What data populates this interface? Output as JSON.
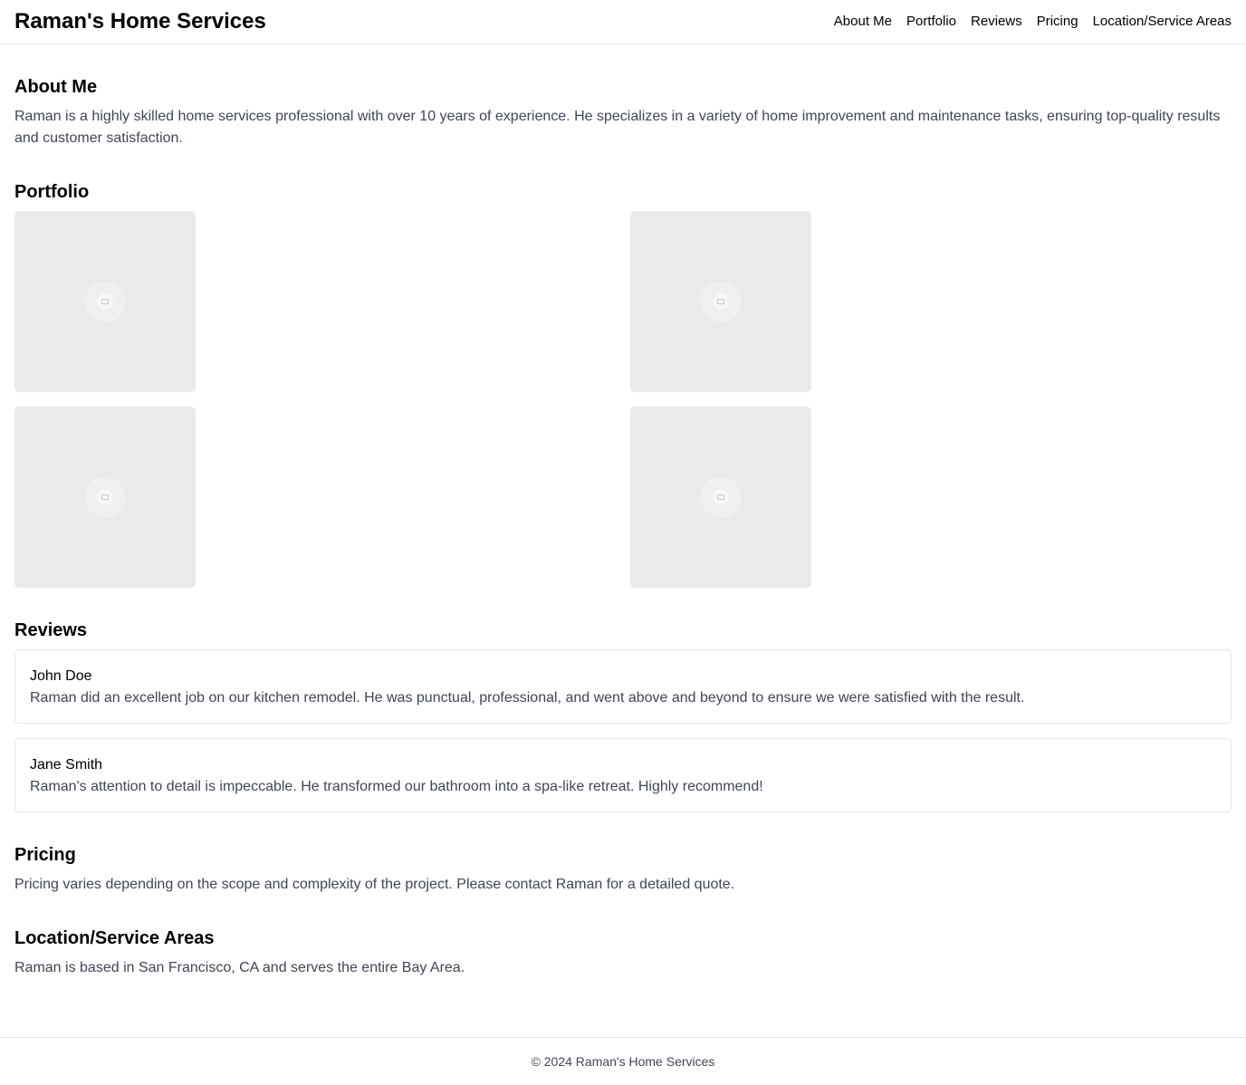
{
  "header": {
    "brand": "Raman's Home Services",
    "nav": [
      "About Me",
      "Portfolio",
      "Reviews",
      "Pricing",
      "Location/Service Areas"
    ]
  },
  "about": {
    "title": "About Me",
    "text": "Raman is a highly skilled home services professional with over 10 years of experience. He specializes in a variety of home improvement and maintenance tasks, ensuring top-quality results and customer satisfaction."
  },
  "portfolio": {
    "title": "Portfolio",
    "images": [
      "image-placeholder-icon",
      "image-placeholder-icon",
      "image-placeholder-icon",
      "image-placeholder-icon"
    ]
  },
  "reviews": {
    "title": "Reviews",
    "items": [
      {
        "name": "John Doe",
        "text": "Raman did an excellent job on our kitchen remodel. He was punctual, professional, and went above and beyond to ensure we were satisfied with the result."
      },
      {
        "name": "Jane Smith",
        "text": "Raman's attention to detail is impeccable. He transformed our bathroom into a spa-like retreat. Highly recommend!"
      }
    ]
  },
  "pricing": {
    "title": "Pricing",
    "text": "Pricing varies depending on the scope and complexity of the project. Please contact Raman for a detailed quote."
  },
  "location": {
    "title": "Location/Service Areas",
    "text": "Raman is based in San Francisco, CA and serves the entire Bay Area."
  },
  "footer": {
    "copyright": "© 2024 Raman's Home Services"
  },
  "colors": {
    "text_primary": "#000000",
    "text_secondary": "#3f4654",
    "border": "#e5e5e5",
    "placeholder_bg": "#eaeaea"
  }
}
